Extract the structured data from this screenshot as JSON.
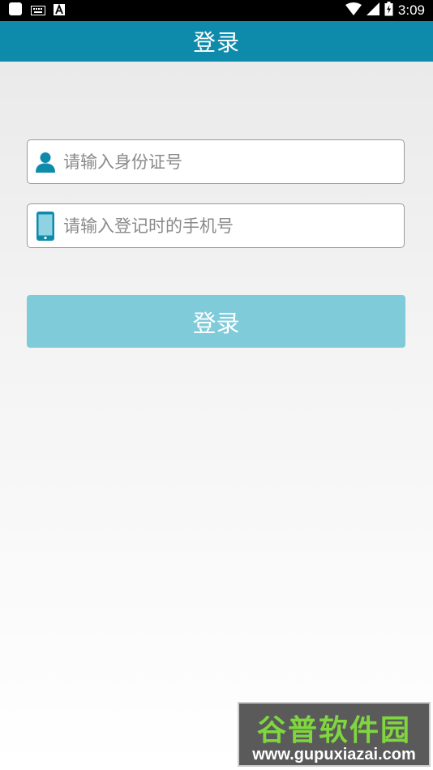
{
  "status_bar": {
    "time": "3:09"
  },
  "header": {
    "title": "登录"
  },
  "form": {
    "id_field": {
      "placeholder": "请输入身份证号",
      "value": "",
      "icon": "user-icon"
    },
    "phone_field": {
      "placeholder": "请输入登记时的手机号",
      "value": "",
      "icon": "phone-icon"
    },
    "login_button_label": "登录"
  },
  "watermark": {
    "name": "谷普软件园",
    "url": "www.gupuxiazai.com"
  },
  "colors": {
    "accent": "#0e8bab",
    "button": "#7fcbd9",
    "status_bar": "#000000"
  }
}
